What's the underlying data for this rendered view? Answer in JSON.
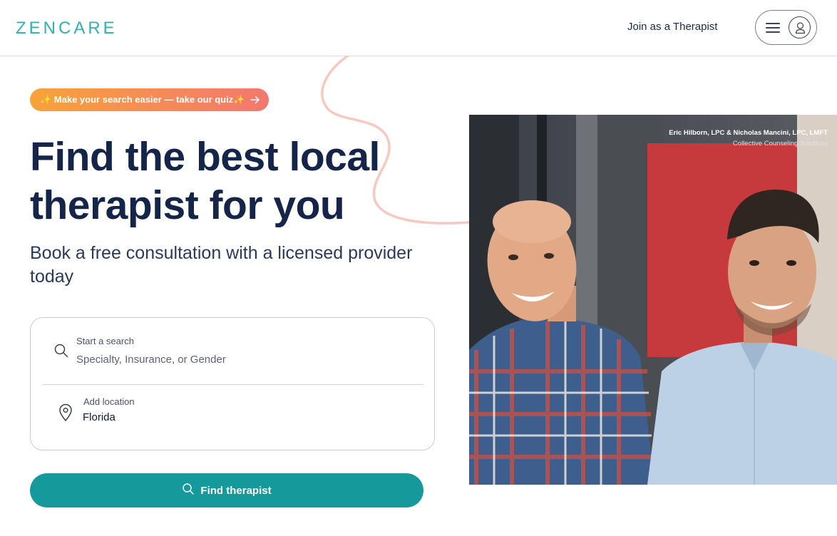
{
  "header": {
    "logo": "ZENCARE",
    "join_link": "Join as a Therapist",
    "menu_icon": "hamburger-icon",
    "account_icon": "user-icon"
  },
  "hero": {
    "quiz_banner": "✨ Make your search easier — take our quiz✨",
    "quiz_arrow_icon": "arrow-right-icon",
    "headline_line1": "Find the best local",
    "headline_line2": "therapist for you",
    "subheadline": "Book a free consultation with a licensed provider today"
  },
  "search": {
    "label": "Start a search",
    "placeholder": "Specialty, Insurance, or Gender",
    "value": "",
    "icon": "search-icon"
  },
  "location": {
    "label": "Add location",
    "value": "Florida",
    "icon": "map-pin-icon"
  },
  "cta": {
    "label": "Find therapist",
    "icon": "search-icon"
  },
  "photo": {
    "caption_names": "Eric Hilborn, LPC & Nicholas Mancini, LPC, LMFT",
    "caption_org": "Collective Counseling Solutions"
  },
  "colors": {
    "brand_teal": "#2bb3b1",
    "button_teal": "#16999a",
    "headline_navy": "#15254a",
    "quiz_gradient_start": "#f7a23a",
    "quiz_gradient_end": "#f4776f",
    "swirl_pink": "#f7c9c0"
  }
}
